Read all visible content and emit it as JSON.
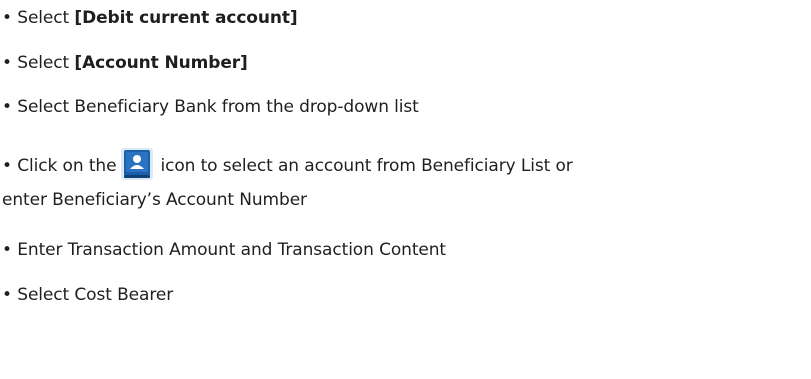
{
  "instructions": {
    "bullet": "•",
    "step1": {
      "prefix": "Select ",
      "emphasis": "[Debit current account]"
    },
    "step2": {
      "prefix": "Select ",
      "emphasis": "[Account Number]"
    },
    "step3": {
      "text": "Select Beneficiary Bank from the drop-down list"
    },
    "step4": {
      "before_icon": "Click on the",
      "icon": "contact-book-icon",
      "after_icon": "icon to select an account from Beneficiary List or",
      "continuation": "enter Beneficiary’s Account Number"
    },
    "step5": {
      "text": "Enter Transaction Amount and Transaction Content"
    },
    "step6": {
      "text": "Select Cost Bearer"
    }
  },
  "colors": {
    "text": "#1f1f1f",
    "icon_blue": "#1b5fa8",
    "icon_light": "#dbe8f6"
  }
}
